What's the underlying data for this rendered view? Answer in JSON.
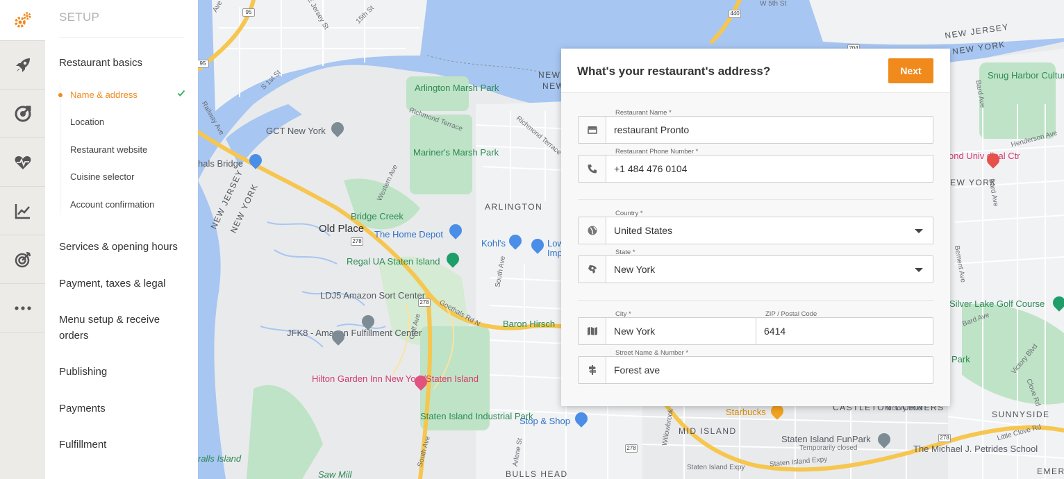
{
  "rail": {
    "icons": [
      "gears-icon",
      "rocket-icon",
      "target-arrow-icon",
      "heart-pulse-icon",
      "chart-line-icon",
      "bullseye-icon",
      "more-dots-icon"
    ]
  },
  "menu": {
    "title": "SETUP",
    "sections": [
      "Restaurant basics",
      "Services & opening hours",
      "Payment, taxes & legal",
      "Menu setup & receive orders",
      "Publishing",
      "Payments",
      "Fulfillment"
    ],
    "sub_items": [
      "Name & address",
      "Location",
      "Restaurant website",
      "Cuisine selector",
      "Account confirmation"
    ],
    "active_sub_item": "Name & address"
  },
  "dialog": {
    "title": "What's your restaurant's address?",
    "next_label": "Next",
    "fields": {
      "name": {
        "label": "Restaurant Name *",
        "value": "restaurant Pronto"
      },
      "phone": {
        "label": "Restaurant Phone Number *",
        "value": "+1 484 476 0104"
      },
      "country": {
        "label": "Country *",
        "value": "United States"
      },
      "state": {
        "label": "State *",
        "value": "New York"
      },
      "city": {
        "label": "City *",
        "value": "New York"
      },
      "zip": {
        "label": "ZIP / Postal Code",
        "value": "6414"
      },
      "street": {
        "label": "Street Name & Number *",
        "value": "Forest ave"
      }
    }
  },
  "map": {
    "labels": {
      "arlington_marsh": "Arlington Marsh Park",
      "mariners_marsh": "Mariner's Marsh Park",
      "gct": "GCT New York",
      "goethals": "hals Bridge",
      "arlington": "ARLINGTON",
      "bridge_creek": "Bridge Creek",
      "old_place": "Old Place",
      "home_depot": "The Home Depot",
      "kohls": "Kohl's",
      "low": "Low",
      "imp": "Imp",
      "regal": "Regal UA Staten Island",
      "ldj5": "LDJ5 Amazon Sort Center",
      "jfk8": "JFK8 - Amazon Fulfillment Center",
      "baron": "Baron Hirsch",
      "hilton": "Hilton Garden Inn New York/Staten Island",
      "staten_industrial": "Staten Island Industrial Park",
      "stop_shop": "Stop & Shop",
      "mid_island": "MID ISLAND",
      "starbucks": "Starbucks",
      "castleton": "CASTLETON CORNERS",
      "funpark": "Staten Island FunPark",
      "temp_closed": "Temporarily closed",
      "petrides": "The Michael J. Petrides School",
      "sunnyside": "SUNNYSIDE",
      "silver_lake": "Silver Lake Golf Course",
      "snug_harbor": "Snug Harbor Cultural Center & Botanical Garden",
      "hospital": "ond Univ dical Ctr",
      "new_jersey_ne": "NEW JERSEY",
      "new_york_ne": "NEW YORK",
      "new_jersey_w": "NEW JERSEY",
      "new_york_w": "NEW YORK",
      "new_c1": "NEW",
      "new_c2": "NEW",
      "ew_york": "EW YORK",
      "bulls_head": "BULLS HEAD",
      "saw_mill": "Saw Mill",
      "ralls_island": "ralls Island",
      "park": "Park",
      "emers": "EMERS",
      "w5th": "W 5th St",
      "ejersey": "E Jersey St",
      "st1": "S 1st St",
      "st15": "15th St",
      "railway": "Railway Ave",
      "richmond_terr": "Richmond Terrace",
      "richmond_terr2": "Richmond Terrace",
      "western": "Western Ave",
      "south_ave": "South Ave",
      "south_ave2": "South Ave",
      "gulf": "Gulf Ave",
      "goethals_rd": "Goethals Rd N",
      "arlene": "Arlene St",
      "willowbrook": "Willowbrook",
      "victory": "Victory Blvd",
      "victory2": "Victory Blvd",
      "little_clove": "Little Clove Rd",
      "clove": "Clove Rd",
      "henderson": "Henderson Ave",
      "bard": "Bard Ave",
      "bard2": "Bard Ave",
      "bement": "Bement Ave",
      "bard3": "Bard Ave",
      "si_expy": "Staten Island Expy",
      "si_expy2": "Staten Island Expy",
      "ave_nw": "Ave",
      "rte95": "95",
      "rte440": "440",
      "rte278a": "278",
      "rte278b": "278",
      "rte278c": "278",
      "rte278d": "278",
      "rte704": "704",
      "rte95b": "95"
    }
  }
}
